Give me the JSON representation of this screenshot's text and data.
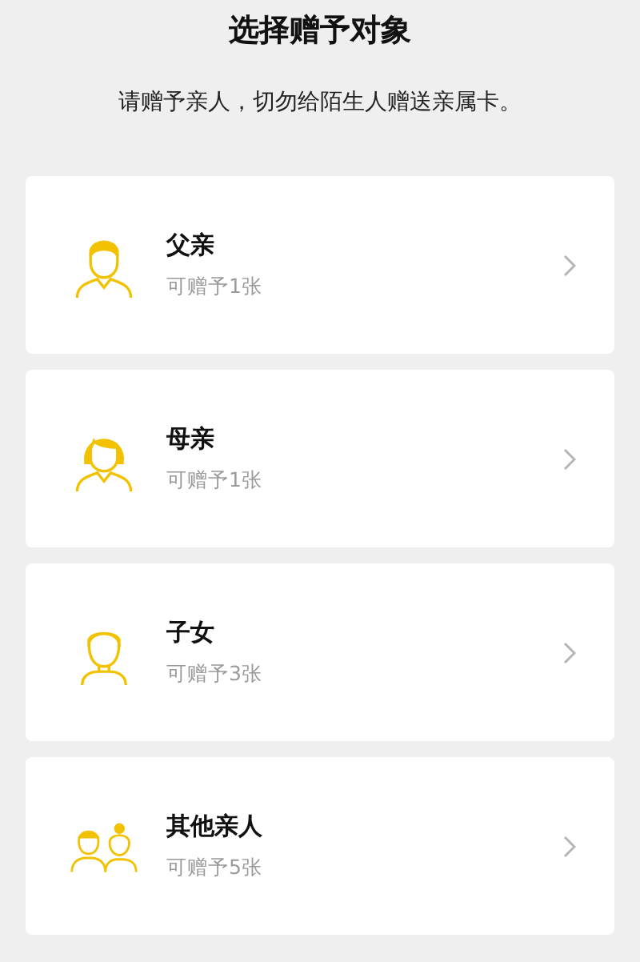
{
  "title": "选择赠予对象",
  "subtitle": "请赠予亲人，切勿给陌生人赠送亲属卡。",
  "recipients": [
    {
      "kind": "father",
      "name": "父亲",
      "quota": "可赠予1张"
    },
    {
      "kind": "mother",
      "name": "母亲",
      "quota": "可赠予1张"
    },
    {
      "kind": "child",
      "name": "子女",
      "quota": "可赠予3张"
    },
    {
      "kind": "others",
      "name": "其他亲人",
      "quota": "可赠予5张"
    }
  ]
}
